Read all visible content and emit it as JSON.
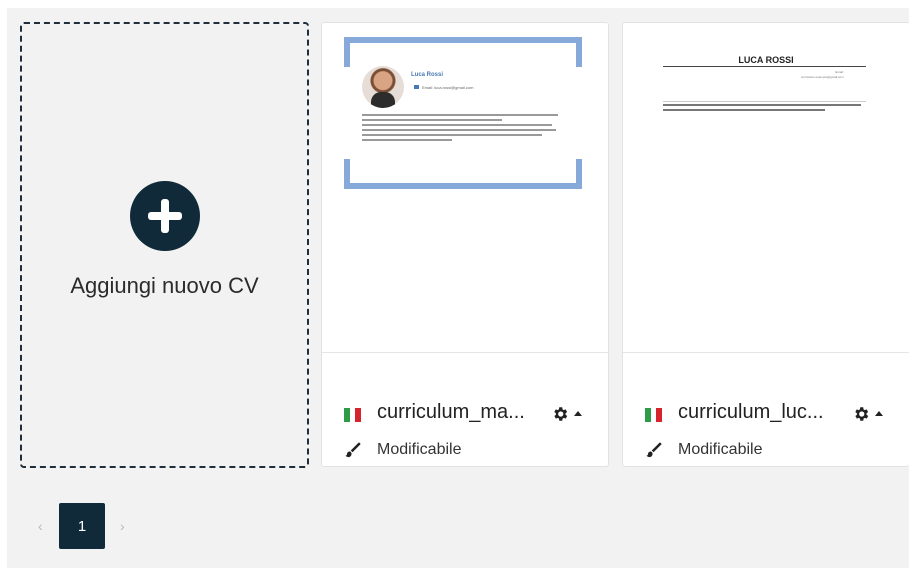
{
  "add_card": {
    "label": "Aggiungi nuovo CV"
  },
  "cards": [
    {
      "filename": "curriculum_ma...",
      "status": "Modificabile",
      "flag": [
        "#2e9b46",
        "#ffffff",
        "#d6242f"
      ],
      "preview": {
        "name": "Luca Rossi",
        "email": "Email: luca.rossi@gmail.com"
      }
    },
    {
      "filename": "curriculum_luc...",
      "status": "Modificabile",
      "flag": [
        "#2e9b46",
        "#ffffff",
        "#d6242f"
      ],
      "preview": {
        "name": "LUCA ROSSI",
        "email_label": "Email:",
        "email": "curriculum.esempio@gmail.com"
      }
    }
  ],
  "pagination": {
    "prev": "‹",
    "current": "1",
    "next": "›"
  },
  "colors": {
    "primary": "#102a39",
    "accent_frame": "#86a9d9"
  }
}
